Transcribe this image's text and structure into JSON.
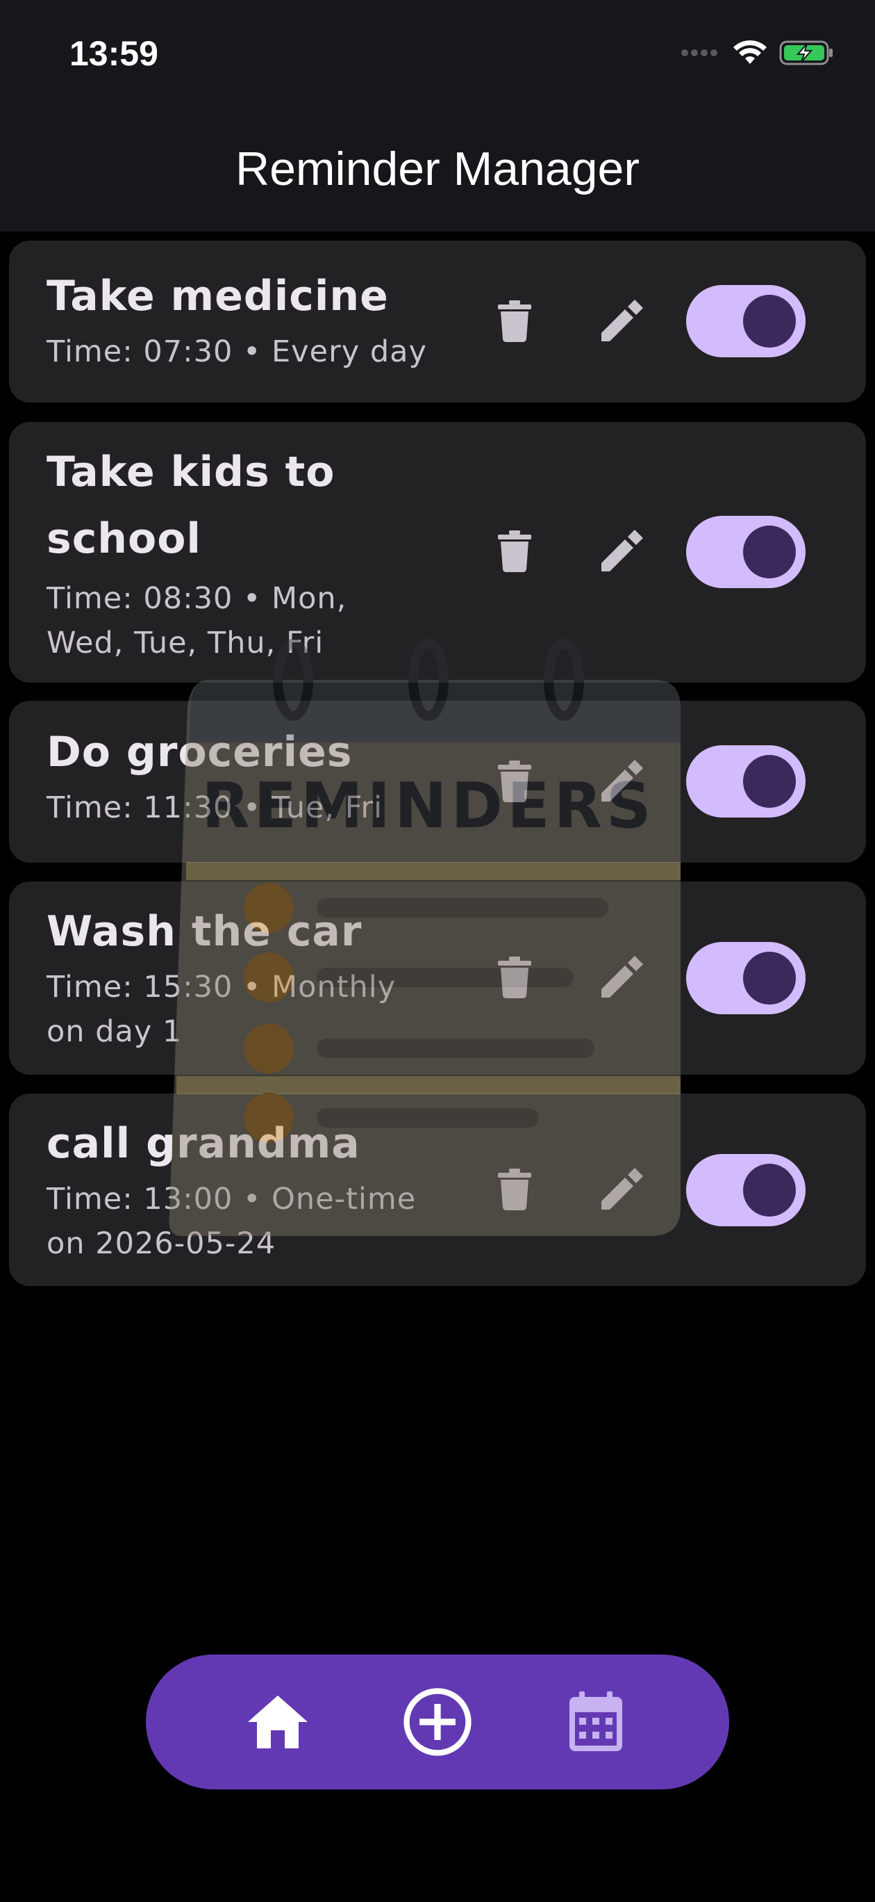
{
  "status_bar": {
    "time": "13:59"
  },
  "app_bar": {
    "title": "Reminder Manager"
  },
  "reminders": [
    {
      "title": "Take medicine",
      "subtitle": "Time: 07:30 • Every day",
      "enabled": true
    },
    {
      "title": "Take kids to school",
      "subtitle": "Time: 08:30 • Mon, Wed, Tue, Thu, Fri",
      "enabled": true
    },
    {
      "title": "Do groceries",
      "subtitle": "Time: 11:30 • Tue, Fri",
      "enabled": true
    },
    {
      "title": "Wash the car",
      "subtitle": "Time: 15:30 • Monthly on day 1",
      "enabled": true
    },
    {
      "title": "call grandma",
      "subtitle": "Time: 13:00 • One-time on 2026-05-24",
      "enabled": true
    }
  ],
  "overlay": {
    "label": "REMINDERS"
  },
  "bottom_nav": {
    "items": [
      "home-icon",
      "add-circle-icon",
      "calendar-icon"
    ]
  },
  "colors": {
    "background": "#000000",
    "card": "#222123",
    "toggle_track": "#d3bcfd",
    "toggle_knob": "#3a2a5c",
    "nav_pill": "#6339b3"
  }
}
